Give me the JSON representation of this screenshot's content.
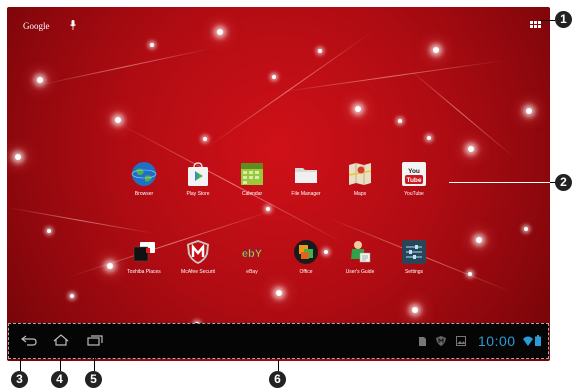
{
  "search": {
    "brand": "Google"
  },
  "apps_row1": [
    {
      "label": "Browser",
      "icon": "globe-icon"
    },
    {
      "label": "Play Store",
      "icon": "play-store-icon"
    },
    {
      "label": "Calendar",
      "icon": "calendar-icon"
    },
    {
      "label": "File Manager",
      "icon": "folder-icon"
    },
    {
      "label": "Maps",
      "icon": "maps-icon"
    },
    {
      "label": "YouTube",
      "icon": "youtube-icon"
    }
  ],
  "apps_row2": [
    {
      "label": "Toshiba Places",
      "icon": "toshiba-places-icon"
    },
    {
      "label": "McAfee Securit",
      "icon": "mcafee-icon"
    },
    {
      "label": "eBay",
      "icon": "ebay-icon"
    },
    {
      "label": "Office",
      "icon": "office-icon"
    },
    {
      "label": "User's Guide",
      "icon": "users-guide-icon"
    },
    {
      "label": "Settings",
      "icon": "settings-icon"
    }
  ],
  "youtube_icon_text": {
    "top": "You",
    "bottom": "Tube"
  },
  "ebay_icon_text": "ebY",
  "status": {
    "time": "10:00"
  },
  "callouts": [
    "1",
    "2",
    "3",
    "4",
    "5",
    "6"
  ],
  "colors": {
    "wallpaper": "#b10c13",
    "clock": "#2a9bd7",
    "navbar": "#050505"
  }
}
